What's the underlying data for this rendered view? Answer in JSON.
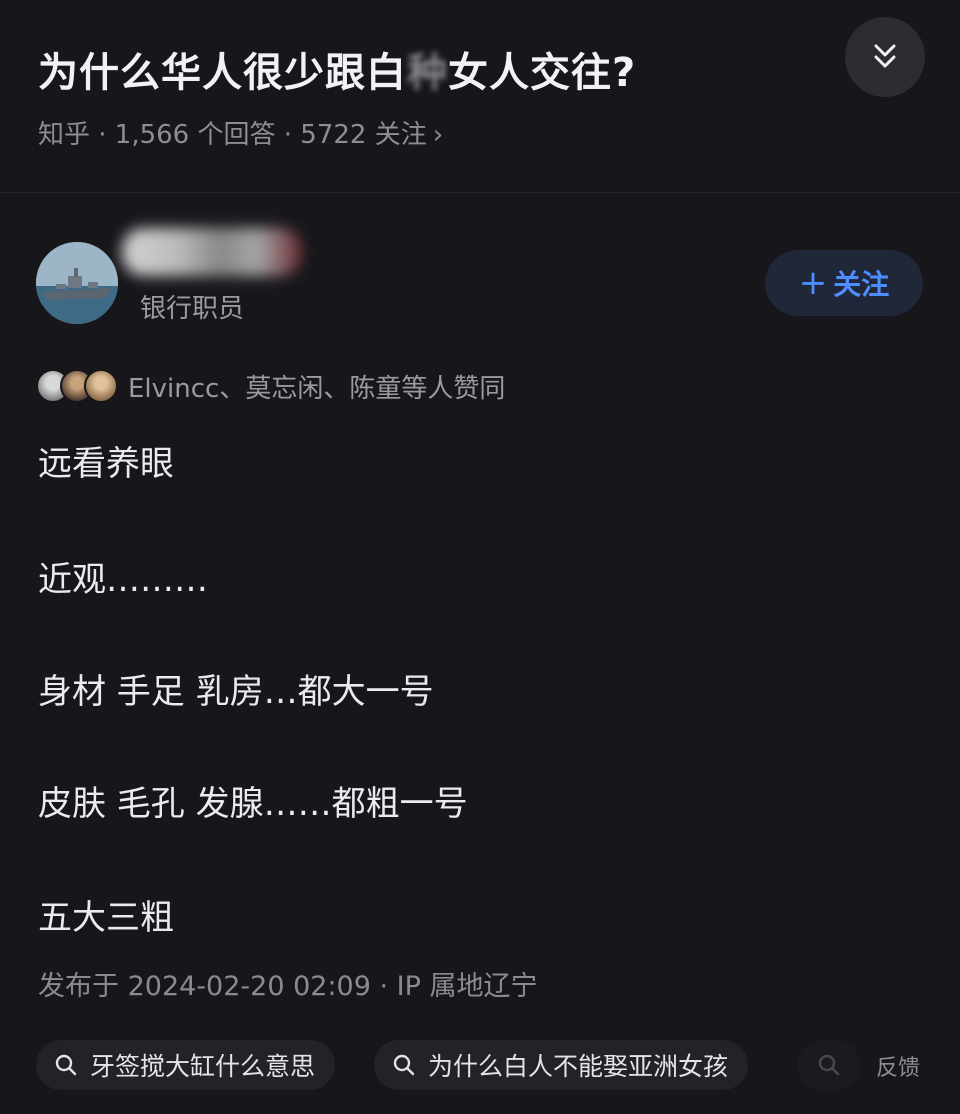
{
  "question": {
    "title_pre": "为什么华人很少跟白",
    "title_blurred": "种",
    "title_post": "女人交往?",
    "meta": "知乎 · 1,566 个回答 · 5722 关注",
    "chevron": "›"
  },
  "author": {
    "title": "银行职员",
    "follow_label": "关注"
  },
  "voters": {
    "text": "Elvincc、莫忘闲、陈童等人赞同"
  },
  "answer": {
    "paragraphs": [
      "远看养眼",
      "近观………",
      "身材 手足 乳房…都大一号",
      "皮肤 毛孔 发腺……都粗一号",
      "五大三粗"
    ]
  },
  "publish": "发布于 2024-02-20 02:09 · IP 属地辽宁",
  "related_searches": [
    "牙签搅大缸什么意思",
    "为什么白人不能娶亚洲女孩"
  ],
  "feedback_label": "反馈",
  "icons": {
    "collapse": "double-chevron-down-icon",
    "search": "search-icon"
  },
  "colors": {
    "background": "#17171b",
    "accent": "#4c8dff"
  }
}
